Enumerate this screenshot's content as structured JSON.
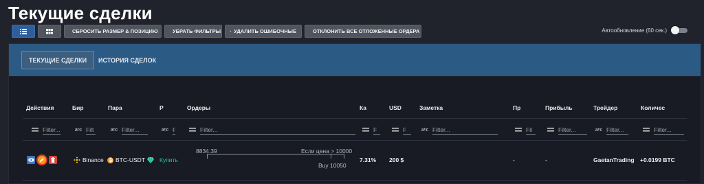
{
  "page": {
    "title": "Текущие сделки"
  },
  "toolbar": {
    "reset_label": "Сбросить размер & позицию",
    "clear_filters_label": "Убрать фильтры",
    "delete_errors_label": "Удалить ошибочные",
    "reject_pending_label": "Отклонить все отложенные ордера"
  },
  "auto_refresh": {
    "label": "Автообновление (60 сек.)",
    "enabled": false
  },
  "tabs": [
    {
      "label": "Текущие сделки",
      "active": true
    },
    {
      "label": "История сделок",
      "active": false
    }
  ],
  "columns": [
    {
      "key": "actions",
      "label": "Действия"
    },
    {
      "key": "exchange",
      "label": "Бир"
    },
    {
      "key": "pair",
      "label": "Пара"
    },
    {
      "key": "side",
      "label": "Р"
    },
    {
      "key": "orders",
      "label": "Ордеры"
    },
    {
      "key": "ka",
      "label": "Ка"
    },
    {
      "key": "usd",
      "label": "USD"
    },
    {
      "key": "note",
      "label": "Заметка"
    },
    {
      "key": "pr",
      "label": "Пр"
    },
    {
      "key": "profit",
      "label": "Прибыль"
    },
    {
      "key": "trader",
      "label": "Трейдер"
    },
    {
      "key": "quantity",
      "label": "Количес"
    }
  ],
  "filters": {
    "placeholder": "Filter...",
    "short_placeholder": "Filt",
    "tiny_placeholder": "F",
    "fil_placeholder": "Fil"
  },
  "row": {
    "exchange": "Binance",
    "pair": "BTC-USDT",
    "side": "Купить",
    "orders": {
      "entry": "8834.39",
      "condition": "Если цена > 10000",
      "buy": "Buy 10050",
      "condition_fraction": 0.9
    },
    "ka": "7.31%",
    "usd": "200 $",
    "note": "",
    "pr": "-",
    "profit": "-",
    "trader": "GaetanTrading",
    "quantity": "+0.0199 BTC"
  },
  "colors": {
    "accent": "#2f5f9b",
    "tabs_bg": "#2b5a85",
    "buy": "#27c496",
    "binance": "#f0b90b",
    "bitcoin": "#f7931a"
  }
}
